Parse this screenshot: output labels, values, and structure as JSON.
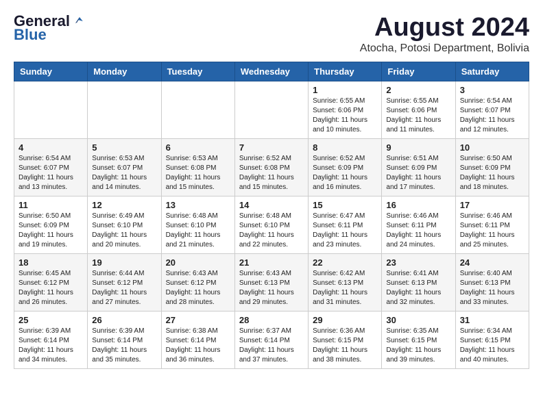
{
  "header": {
    "logo_general": "General",
    "logo_blue": "Blue",
    "month_year": "August 2024",
    "location": "Atocha, Potosi Department, Bolivia"
  },
  "days_of_week": [
    "Sunday",
    "Monday",
    "Tuesday",
    "Wednesday",
    "Thursday",
    "Friday",
    "Saturday"
  ],
  "weeks": [
    [
      {
        "day": "",
        "info": ""
      },
      {
        "day": "",
        "info": ""
      },
      {
        "day": "",
        "info": ""
      },
      {
        "day": "",
        "info": ""
      },
      {
        "day": "1",
        "info": "Sunrise: 6:55 AM\nSunset: 6:06 PM\nDaylight: 11 hours\nand 10 minutes."
      },
      {
        "day": "2",
        "info": "Sunrise: 6:55 AM\nSunset: 6:06 PM\nDaylight: 11 hours\nand 11 minutes."
      },
      {
        "day": "3",
        "info": "Sunrise: 6:54 AM\nSunset: 6:07 PM\nDaylight: 11 hours\nand 12 minutes."
      }
    ],
    [
      {
        "day": "4",
        "info": "Sunrise: 6:54 AM\nSunset: 6:07 PM\nDaylight: 11 hours\nand 13 minutes."
      },
      {
        "day": "5",
        "info": "Sunrise: 6:53 AM\nSunset: 6:07 PM\nDaylight: 11 hours\nand 14 minutes."
      },
      {
        "day": "6",
        "info": "Sunrise: 6:53 AM\nSunset: 6:08 PM\nDaylight: 11 hours\nand 15 minutes."
      },
      {
        "day": "7",
        "info": "Sunrise: 6:52 AM\nSunset: 6:08 PM\nDaylight: 11 hours\nand 15 minutes."
      },
      {
        "day": "8",
        "info": "Sunrise: 6:52 AM\nSunset: 6:09 PM\nDaylight: 11 hours\nand 16 minutes."
      },
      {
        "day": "9",
        "info": "Sunrise: 6:51 AM\nSunset: 6:09 PM\nDaylight: 11 hours\nand 17 minutes."
      },
      {
        "day": "10",
        "info": "Sunrise: 6:50 AM\nSunset: 6:09 PM\nDaylight: 11 hours\nand 18 minutes."
      }
    ],
    [
      {
        "day": "11",
        "info": "Sunrise: 6:50 AM\nSunset: 6:09 PM\nDaylight: 11 hours\nand 19 minutes."
      },
      {
        "day": "12",
        "info": "Sunrise: 6:49 AM\nSunset: 6:10 PM\nDaylight: 11 hours\nand 20 minutes."
      },
      {
        "day": "13",
        "info": "Sunrise: 6:48 AM\nSunset: 6:10 PM\nDaylight: 11 hours\nand 21 minutes."
      },
      {
        "day": "14",
        "info": "Sunrise: 6:48 AM\nSunset: 6:10 PM\nDaylight: 11 hours\nand 22 minutes."
      },
      {
        "day": "15",
        "info": "Sunrise: 6:47 AM\nSunset: 6:11 PM\nDaylight: 11 hours\nand 23 minutes."
      },
      {
        "day": "16",
        "info": "Sunrise: 6:46 AM\nSunset: 6:11 PM\nDaylight: 11 hours\nand 24 minutes."
      },
      {
        "day": "17",
        "info": "Sunrise: 6:46 AM\nSunset: 6:11 PM\nDaylight: 11 hours\nand 25 minutes."
      }
    ],
    [
      {
        "day": "18",
        "info": "Sunrise: 6:45 AM\nSunset: 6:12 PM\nDaylight: 11 hours\nand 26 minutes."
      },
      {
        "day": "19",
        "info": "Sunrise: 6:44 AM\nSunset: 6:12 PM\nDaylight: 11 hours\nand 27 minutes."
      },
      {
        "day": "20",
        "info": "Sunrise: 6:43 AM\nSunset: 6:12 PM\nDaylight: 11 hours\nand 28 minutes."
      },
      {
        "day": "21",
        "info": "Sunrise: 6:43 AM\nSunset: 6:13 PM\nDaylight: 11 hours\nand 29 minutes."
      },
      {
        "day": "22",
        "info": "Sunrise: 6:42 AM\nSunset: 6:13 PM\nDaylight: 11 hours\nand 31 minutes."
      },
      {
        "day": "23",
        "info": "Sunrise: 6:41 AM\nSunset: 6:13 PM\nDaylight: 11 hours\nand 32 minutes."
      },
      {
        "day": "24",
        "info": "Sunrise: 6:40 AM\nSunset: 6:13 PM\nDaylight: 11 hours\nand 33 minutes."
      }
    ],
    [
      {
        "day": "25",
        "info": "Sunrise: 6:39 AM\nSunset: 6:14 PM\nDaylight: 11 hours\nand 34 minutes."
      },
      {
        "day": "26",
        "info": "Sunrise: 6:39 AM\nSunset: 6:14 PM\nDaylight: 11 hours\nand 35 minutes."
      },
      {
        "day": "27",
        "info": "Sunrise: 6:38 AM\nSunset: 6:14 PM\nDaylight: 11 hours\nand 36 minutes."
      },
      {
        "day": "28",
        "info": "Sunrise: 6:37 AM\nSunset: 6:14 PM\nDaylight: 11 hours\nand 37 minutes."
      },
      {
        "day": "29",
        "info": "Sunrise: 6:36 AM\nSunset: 6:15 PM\nDaylight: 11 hours\nand 38 minutes."
      },
      {
        "day": "30",
        "info": "Sunrise: 6:35 AM\nSunset: 6:15 PM\nDaylight: 11 hours\nand 39 minutes."
      },
      {
        "day": "31",
        "info": "Sunrise: 6:34 AM\nSunset: 6:15 PM\nDaylight: 11 hours\nand 40 minutes."
      }
    ]
  ]
}
